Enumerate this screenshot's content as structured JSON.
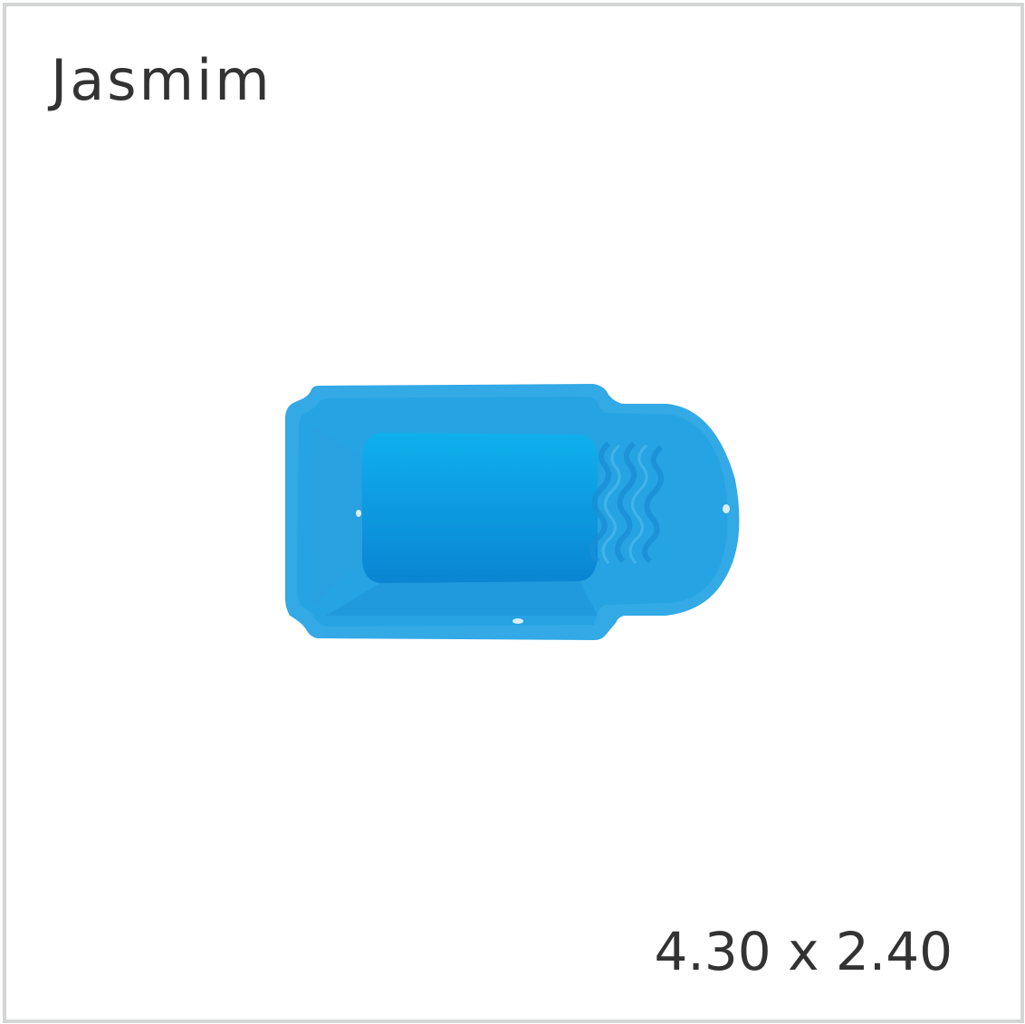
{
  "product": {
    "name": "Jasmim",
    "dimensions": "4.30 x 2.40"
  },
  "colors": {
    "pool_rim": "#2fa8e4",
    "pool_inner": "#1a9be0",
    "pool_deep": "#0f8bd6",
    "text": "#333333",
    "frame_border": "#d4d5d5"
  },
  "image": {
    "icon": "pool-top-view-icon"
  }
}
